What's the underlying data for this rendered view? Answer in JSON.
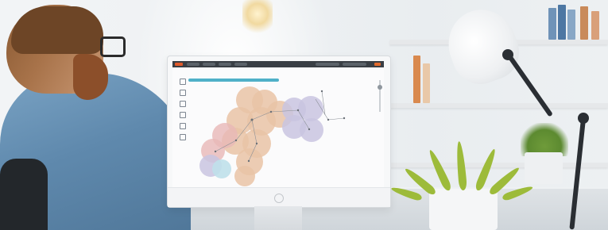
{
  "scene": {
    "description_tags": [
      "person-at-desk",
      "monitor",
      "desk-lamp",
      "plant",
      "bookshelf"
    ]
  },
  "screen": {
    "app_tags": [
      "mind-map-app"
    ],
    "colors": {
      "accent": "#e05a2b",
      "topbar": "#3a3f45",
      "progress": "#4fb0c8",
      "cluster_peach": "#e9c3a6",
      "cluster_lavender": "#c9c4e0",
      "cluster_pink": "#e8b8b6"
    }
  },
  "icons": {
    "power": "power-icon",
    "sidebar": [
      "home-icon",
      "share-icon",
      "list-icon",
      "user-icon",
      "chart-icon",
      "settings-icon"
    ]
  }
}
